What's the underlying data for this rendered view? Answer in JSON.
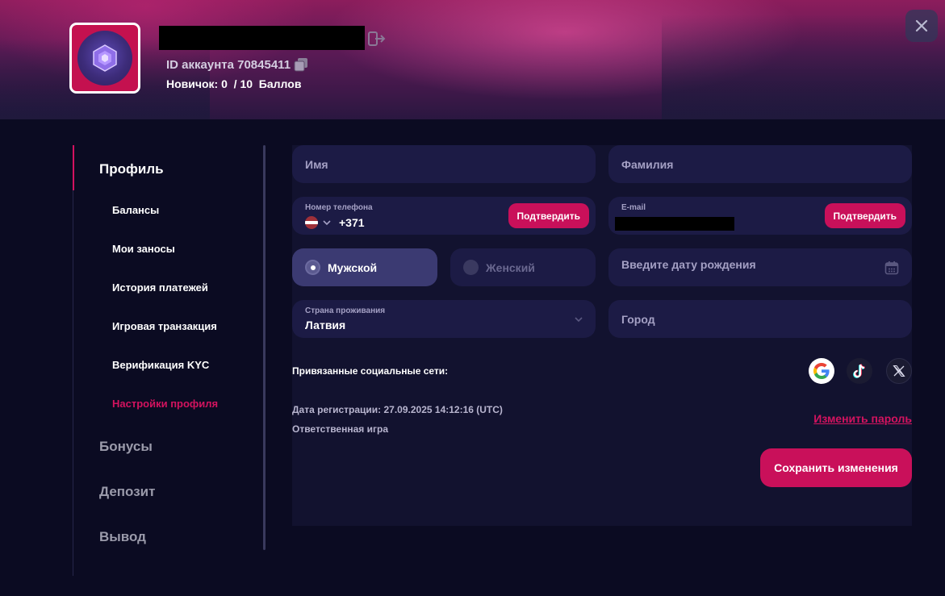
{
  "header": {
    "account_id_label": "ID аккаунта 70845411",
    "level_text": "Новичок: 0  / 10  Баллов"
  },
  "sidebar": {
    "items": [
      {
        "label": "Профиль",
        "level": "main",
        "active": true
      },
      {
        "label": "Балансы",
        "level": "sub"
      },
      {
        "label": "Мои заносы",
        "level": "sub"
      },
      {
        "label": "История платежей",
        "level": "sub"
      },
      {
        "label": "Игровая транзакция",
        "level": "sub"
      },
      {
        "label": "Верификация KYC",
        "level": "sub"
      },
      {
        "label": "Настройки профиля",
        "level": "sub",
        "active": true
      },
      {
        "label": "Бонусы",
        "level": "main"
      },
      {
        "label": "Депозит",
        "level": "main"
      },
      {
        "label": "Вывод",
        "level": "main"
      }
    ]
  },
  "form": {
    "first_name_placeholder": "Имя",
    "last_name_placeholder": "Фамилия",
    "phone_label": "Номер телефона",
    "phone_code": "+371",
    "phone_confirm": "Подтвердить",
    "email_label": "E-mail",
    "email_confirm": "Подтвердить",
    "gender_male": "Мужской",
    "gender_female": "Женский",
    "birthdate_placeholder": "Введите дату рождения",
    "country_label": "Страна проживания",
    "country_value": "Латвия",
    "city_placeholder": "Город",
    "social_label": "Привязанные социальные сети:",
    "registration_date": "Дата регистрации: 27.09.2025 14:12:16 (UTC)",
    "responsible_game": "Ответственная игра",
    "change_password": "Изменить пароль",
    "save_button": "Сохранить изменения"
  },
  "icons": {
    "logout": "logout-icon",
    "copy": "copy-icon",
    "close": "close-icon",
    "calendar": "calendar-icon",
    "chevron": "chevron-down-icon",
    "flag": "latvia-flag-icon",
    "social": [
      "google-icon",
      "tiktok-icon",
      "x-icon"
    ]
  },
  "colors": {
    "accent": "#c9105a",
    "background": "#0b0b22",
    "panel": "#12122f",
    "field": "#1c1b45"
  }
}
